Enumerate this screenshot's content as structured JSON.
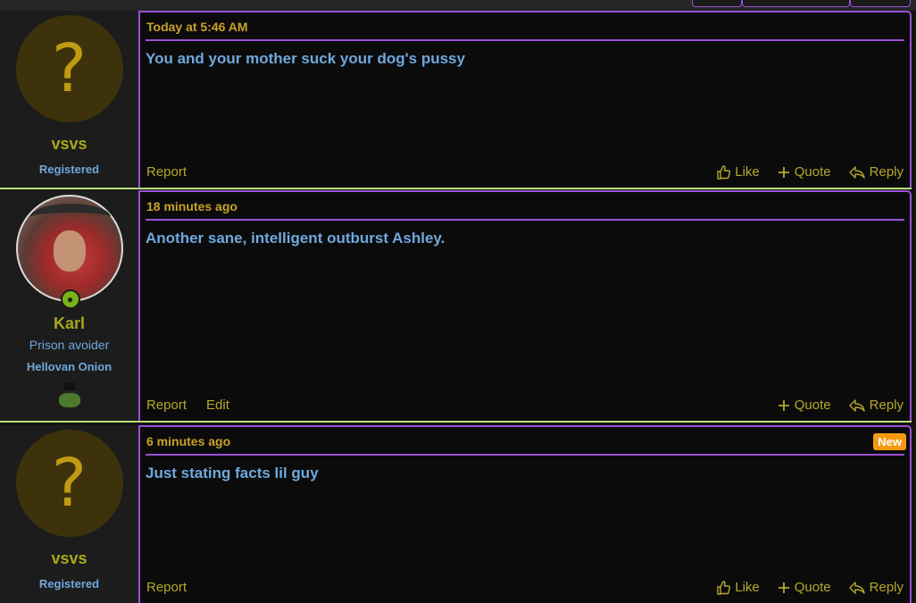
{
  "colors": {
    "accent_purple": "#9b4fd6",
    "separator_green": "#b8e07a",
    "username": "#a8a81a",
    "timestamp": "#c9a227",
    "body_text": "#6fa8dc",
    "action_text": "#b5a82a",
    "new_badge": "#f39a11",
    "online": "#7ab317"
  },
  "posts": [
    {
      "avatar_glyph": "?",
      "username": "vsvs",
      "user_banner": "Registered",
      "time": "Today at 5:46 AM",
      "body": "You and your mother suck your dog's pussy",
      "actions_left": [
        "Report"
      ],
      "like": "Like",
      "quote": "Quote",
      "reply": "Reply"
    },
    {
      "username": "Karl",
      "user_title": "Prison avoider",
      "user_banner": "Hellovan Onion",
      "time": "18 minutes ago",
      "body": "Another sane, intelligent outburst Ashley.",
      "actions_left": [
        "Report",
        "Edit"
      ],
      "quote": "Quote",
      "reply": "Reply"
    },
    {
      "avatar_glyph": "?",
      "username": "vsvs",
      "user_banner": "Registered",
      "time": "6 minutes ago",
      "badge": "New",
      "body": "Just stating facts lil guy",
      "actions_left": [
        "Report"
      ],
      "like": "Like",
      "quote": "Quote",
      "reply": "Reply"
    }
  ]
}
